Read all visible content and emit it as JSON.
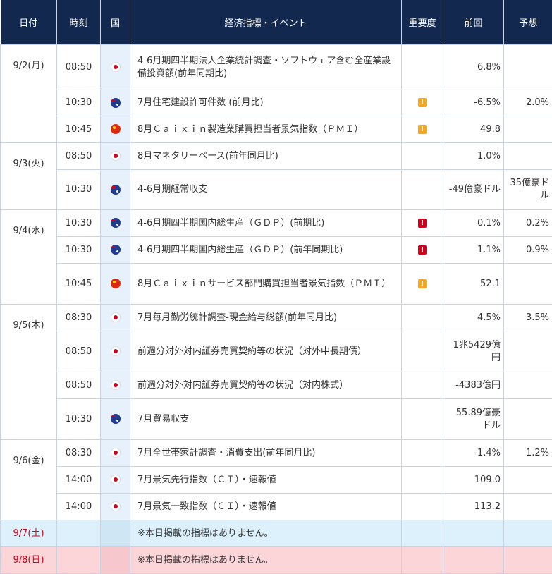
{
  "headers": {
    "date": "日付",
    "time": "時刻",
    "country": "国",
    "event": "経済指標・イベント",
    "importance": "重要度",
    "previous": "前回",
    "forecast": "予想"
  },
  "days": [
    {
      "date": "9/2(月)",
      "rows": [
        {
          "time": "08:50",
          "country": "jp",
          "event": "4-6月期四半期法人企業統計調査・ソフトウェア含む全産業設備投資額(前年同期比)",
          "importance": "",
          "previous": "6.8%",
          "forecast": ""
        },
        {
          "time": "10:30",
          "country": "au",
          "event": "7月住宅建設許可件数 (前月比)",
          "importance": "mid",
          "previous": "-6.5%",
          "forecast": "2.0%"
        },
        {
          "time": "10:45",
          "country": "cn",
          "event": "8月Ｃａｉｘｉｎ製造業購買担当者景気指数（ＰＭＩ）",
          "importance": "mid",
          "previous": "49.8",
          "forecast": ""
        }
      ]
    },
    {
      "date": "9/3(火)",
      "rows": [
        {
          "time": "08:50",
          "country": "jp",
          "event": "8月マネタリーベース(前年同月比)",
          "importance": "",
          "previous": "1.0%",
          "forecast": ""
        },
        {
          "time": "10:30",
          "country": "au",
          "event": "4-6月期経常収支",
          "importance": "",
          "previous": "-49億豪ドル",
          "forecast": "35億豪ドル"
        }
      ]
    },
    {
      "date": "9/4(水)",
      "rows": [
        {
          "time": "10:30",
          "country": "au",
          "event": "4-6月期四半期国内総生産（ＧＤＰ）(前期比)",
          "importance": "high",
          "previous": "0.1%",
          "forecast": "0.2%"
        },
        {
          "time": "10:30",
          "country": "au",
          "event": "4-6月期四半期国内総生産（ＧＤＰ）(前年同期比)",
          "importance": "high",
          "previous": "1.1%",
          "forecast": "0.9%"
        },
        {
          "time": "10:45",
          "country": "cn",
          "event": "8月Ｃａｉｘｉｎサービス部門購買担当者景気指数（ＰＭＩ）",
          "importance": "mid",
          "previous": "52.1",
          "forecast": ""
        }
      ]
    },
    {
      "date": "9/5(木)",
      "rows": [
        {
          "time": "08:30",
          "country": "jp",
          "event": "7月毎月勤労統計調査-現金給与総額(前年同月比)",
          "importance": "",
          "previous": "4.5%",
          "forecast": "3.5%"
        },
        {
          "time": "08:50",
          "country": "jp",
          "event": "前週分対外対内証券売買契約等の状況（対外中長期債）",
          "importance": "",
          "previous": "1兆5429億円",
          "forecast": ""
        },
        {
          "time": "08:50",
          "country": "jp",
          "event": "前週分対外対内証券売買契約等の状況（対内株式）",
          "importance": "",
          "previous": "-4383億円",
          "forecast": ""
        },
        {
          "time": "10:30",
          "country": "au",
          "event": "7月貿易収支",
          "importance": "",
          "previous": "55.89億豪ドル",
          "forecast": ""
        }
      ]
    },
    {
      "date": "9/6(金)",
      "rows": [
        {
          "time": "08:30",
          "country": "jp",
          "event": "7月全世帯家計調査・消費支出(前年同月比)",
          "importance": "",
          "previous": "-1.4%",
          "forecast": "1.2%"
        },
        {
          "time": "14:00",
          "country": "jp",
          "event": "7月景気先行指数（ＣＩ）・速報値",
          "importance": "",
          "previous": "109.0",
          "forecast": ""
        },
        {
          "time": "14:00",
          "country": "jp",
          "event": "7月景気一致指数（ＣＩ）・速報値",
          "importance": "",
          "previous": "113.2",
          "forecast": ""
        }
      ]
    }
  ],
  "weekend": [
    {
      "date": "9/7(土)",
      "kind": "sat",
      "message": "※本日掲載の指標はありません。"
    },
    {
      "date": "9/8(日)",
      "kind": "sun",
      "message": "※本日掲載の指標はありません。"
    }
  ],
  "importance_icon": "!",
  "colors": {
    "header_bg": "#12284f",
    "importance_mid": "#f5a623",
    "importance_high": "#d0021b",
    "weekend_red": "#d0021b"
  }
}
